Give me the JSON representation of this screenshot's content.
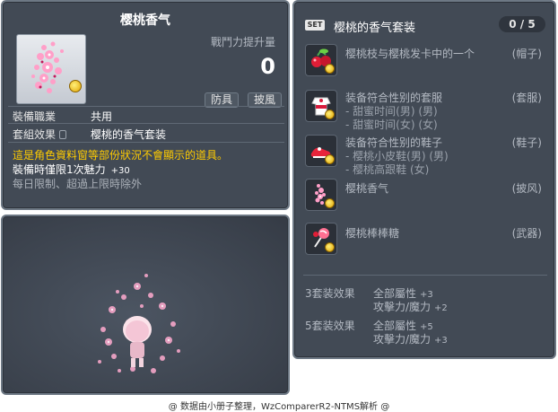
{
  "item_id": "01103013",
  "item": {
    "name": "樱桃香气",
    "power_label": "戰鬥力提升量",
    "power_value": "0",
    "tags": [
      "防具",
      "披風"
    ],
    "job_label": "裝備職業",
    "job_value": "共用",
    "set_label": "套組效果",
    "set_value": "樱桃的香气套装",
    "warning": "這是角色資料窗等部份狀況不會顯示的道具。",
    "limit_text": "裝備時僅限1次魅力",
    "limit_bonus": "+30",
    "daily_text": "每日限制、超過上限時除外"
  },
  "set": {
    "badge": "SET",
    "title": "樱桃的香气套装",
    "count": "0 / 5",
    "items": [
      {
        "name": "樱桃枝与樱桃发卡中的一个",
        "type": "(帽子)",
        "subs": [],
        "icon": "cherry-hat-icon"
      },
      {
        "name": "装备符合性别的套服",
        "type": "(套服)",
        "subs": [
          "- 甜蜜时间(男) (男)",
          "- 甜蜜时间(女) (女)"
        ],
        "icon": "suit-icon"
      },
      {
        "name": "装备符合性别的鞋子",
        "type": "(鞋子)",
        "subs": [
          "- 樱桃小皮鞋(男) (男)",
          "- 樱桃高跟鞋 (女)"
        ],
        "icon": "shoes-icon"
      },
      {
        "name": "樱桃香气",
        "type": "(披风)",
        "subs": [],
        "icon": "cherry-aroma-icon"
      },
      {
        "name": "樱桃棒棒糖",
        "type": "(武器)",
        "subs": [],
        "icon": "lollipop-icon"
      }
    ],
    "effects": [
      {
        "label": "3套装效果",
        "lines": [
          {
            "text": "全部屬性",
            "value": "+3"
          },
          {
            "text": "攻擊力/魔力",
            "value": "+2"
          }
        ]
      },
      {
        "label": "5套装效果",
        "lines": [
          {
            "text": "全部屬性",
            "value": "+5"
          },
          {
            "text": "攻擊力/魔力",
            "value": "+3"
          }
        ]
      }
    ]
  },
  "footer": "@ 数据由小册子整理，WzComparerR2-NTMS解析 @"
}
